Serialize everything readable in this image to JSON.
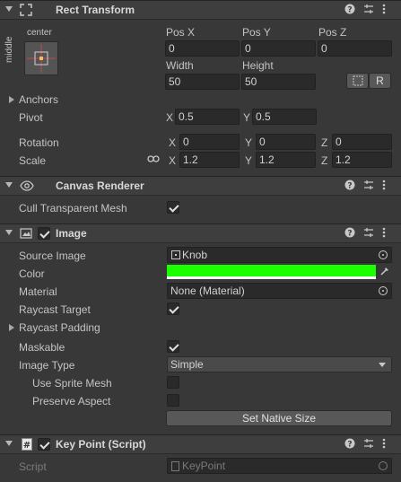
{
  "rect_transform": {
    "title": "Rect Transform",
    "anchor_h": "center",
    "anchor_v": "middle",
    "col_labels": [
      "Pos X",
      "Pos Y",
      "Pos Z"
    ],
    "pos": [
      "0",
      "0",
      "0"
    ],
    "size_labels": [
      "Width",
      "Height"
    ],
    "size": [
      "50",
      "50"
    ],
    "raw_button": "R",
    "anchors_label": "Anchors",
    "pivot_label": "Pivot",
    "pivot": {
      "x_label": "X",
      "x": "0.5",
      "y_label": "Y",
      "y": "0.5"
    },
    "rotation_label": "Rotation",
    "rotation": {
      "x_label": "X",
      "x": "0",
      "y_label": "Y",
      "y": "0",
      "z_label": "Z",
      "z": "0"
    },
    "scale_label": "Scale",
    "scale": {
      "x_label": "X",
      "x": "1.2",
      "y_label": "Y",
      "y": "1.2",
      "z_label": "Z",
      "z": "1.2"
    }
  },
  "canvas_renderer": {
    "title": "Canvas Renderer",
    "cull_label": "Cull Transparent Mesh",
    "cull_checked": true
  },
  "image": {
    "title": "Image",
    "source_image_label": "Source Image",
    "source_image": "Knob",
    "color_label": "Color",
    "color_value": "#1bff00",
    "material_label": "Material",
    "material": "None (Material)",
    "raycast_target_label": "Raycast Target",
    "raycast_padding_label": "Raycast Padding",
    "maskable_label": "Maskable",
    "image_type_label": "Image Type",
    "image_type": "Simple",
    "use_sprite_mesh_label": "Use Sprite Mesh",
    "preserve_aspect_label": "Preserve Aspect",
    "set_native_size": "Set Native Size"
  },
  "key_point": {
    "title": "Key Point (Script)",
    "script_label": "Script",
    "script": "KeyPoint"
  }
}
